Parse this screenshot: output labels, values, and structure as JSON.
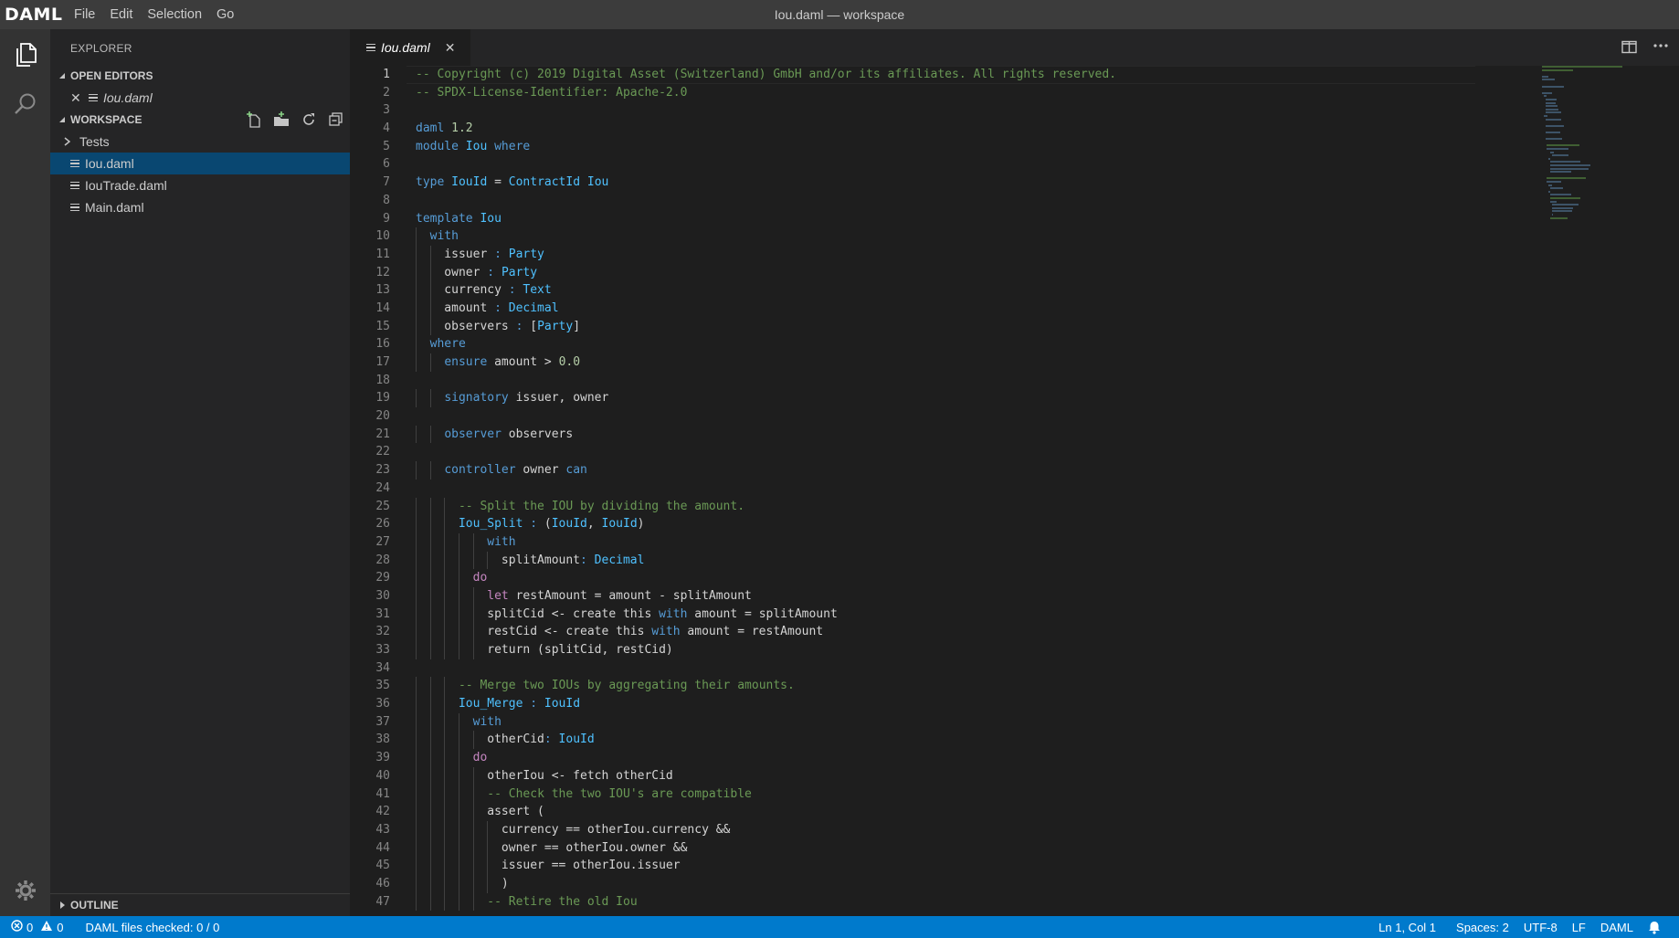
{
  "app": {
    "logo": "DAML",
    "window_title": "Iou.daml — workspace",
    "menu": [
      "File",
      "Edit",
      "Selection",
      "Go"
    ]
  },
  "sidebar": {
    "title": "EXPLORER",
    "open_editors": {
      "header": "OPEN EDITORS",
      "items": [
        {
          "label": "Iou.daml"
        }
      ]
    },
    "workspace": {
      "header": "WORKSPACE",
      "items": [
        {
          "label": "Tests",
          "type": "folder"
        },
        {
          "label": "Iou.daml",
          "type": "file",
          "selected": true
        },
        {
          "label": "IouTrade.daml",
          "type": "file"
        },
        {
          "label": "Main.daml",
          "type": "file"
        }
      ]
    },
    "outline": {
      "header": "OUTLINE"
    }
  },
  "editor": {
    "tab": {
      "label": "Iou.daml"
    },
    "active_line": 1,
    "lines": [
      "-- Copyright (c) 2019 Digital Asset (Switzerland) GmbH and/or its affiliates. All rights reserved.",
      "-- SPDX-License-Identifier: Apache-2.0",
      "",
      "daml 1.2",
      "module Iou where",
      "",
      "type IouId = ContractId Iou",
      "",
      "template Iou",
      "  with",
      "    issuer : Party",
      "    owner : Party",
      "    currency : Text",
      "    amount : Decimal",
      "    observers : [Party]",
      "  where",
      "    ensure amount > 0.0",
      "",
      "    signatory issuer, owner",
      "",
      "    observer observers",
      "",
      "    controller owner can",
      "",
      "      -- Split the IOU by dividing the amount.",
      "      Iou_Split : (IouId, IouId)",
      "          with",
      "            splitAmount: Decimal",
      "        do",
      "          let restAmount = amount - splitAmount",
      "          splitCid <- create this with amount = splitAmount",
      "          restCid <- create this with amount = restAmount",
      "          return (splitCid, restCid)",
      "",
      "      -- Merge two IOUs by aggregating their amounts.",
      "      Iou_Merge : IouId",
      "        with",
      "          otherCid: IouId",
      "        do",
      "          otherIou <- fetch otherCid",
      "          -- Check the two IOU's are compatible",
      "          assert (",
      "            currency == otherIou.currency &&",
      "            owner == otherIou.owner &&",
      "            issuer == otherIou.issuer",
      "            )",
      "          -- Retire the old Iou"
    ]
  },
  "statusbar": {
    "errors": "0",
    "warnings": "0",
    "message": "DAML files checked: 0 / 0",
    "position": "Ln 1, Col 1",
    "spaces": "Spaces: 2",
    "encoding": "UTF-8",
    "eol": "LF",
    "language": "DAML"
  },
  "colors": {
    "accent": "#007acc",
    "selection": "#094771",
    "comment": "#6a9955",
    "keyword": "#569cd6",
    "control": "#c586c0",
    "number": "#b5cea8"
  },
  "icons": [
    "files-icon",
    "search-icon",
    "gear-icon",
    "close-icon",
    "new-file-icon",
    "new-folder-icon",
    "refresh-icon",
    "collapse-all-icon",
    "split-editor-icon",
    "more-actions-icon",
    "error-icon",
    "warning-icon",
    "bell-icon"
  ]
}
